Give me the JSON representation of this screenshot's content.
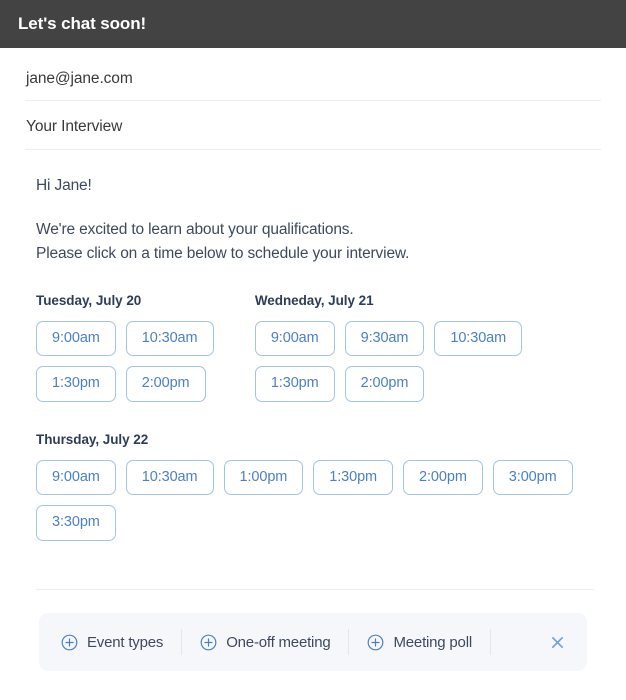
{
  "header": {
    "title": "Let's chat soon!"
  },
  "fields": {
    "recipient": "jane@jane.com",
    "subject": "Your Interview"
  },
  "message": {
    "greeting": "Hi Jane!",
    "line1": "We're excited to learn about your qualifications.",
    "line2": "Please click on a time below to schedule your interview."
  },
  "days": [
    {
      "heading": "Tuesday, July 20",
      "slots": [
        "9:00am",
        "10:30am",
        "1:30pm",
        "2:00pm"
      ]
    },
    {
      "heading": "Wedneday, July 21",
      "slots": [
        "9:00am",
        "9:30am",
        "10:30am",
        "1:30pm",
        "2:00pm"
      ]
    },
    {
      "heading": "Thursday, July 22",
      "slots": [
        "9:00am",
        "10:30am",
        "1:00pm",
        "1:30pm",
        "2:00pm",
        "3:00pm",
        "3:30pm"
      ]
    }
  ],
  "toolbar": {
    "items": [
      {
        "icon": "plus-circle-icon",
        "label": "Event types"
      },
      {
        "icon": "plus-circle-icon",
        "label": "One-off meeting"
      },
      {
        "icon": "plus-circle-icon",
        "label": "Meeting poll"
      }
    ],
    "close_icon": "close-icon"
  },
  "colors": {
    "header_bg": "#434343",
    "slot_border": "#a4c3e8",
    "slot_text": "#4b81c4",
    "body_text": "#3e4a5c",
    "heading_text": "#2c3e56",
    "toolbar_bg": "#f5f7fb"
  }
}
